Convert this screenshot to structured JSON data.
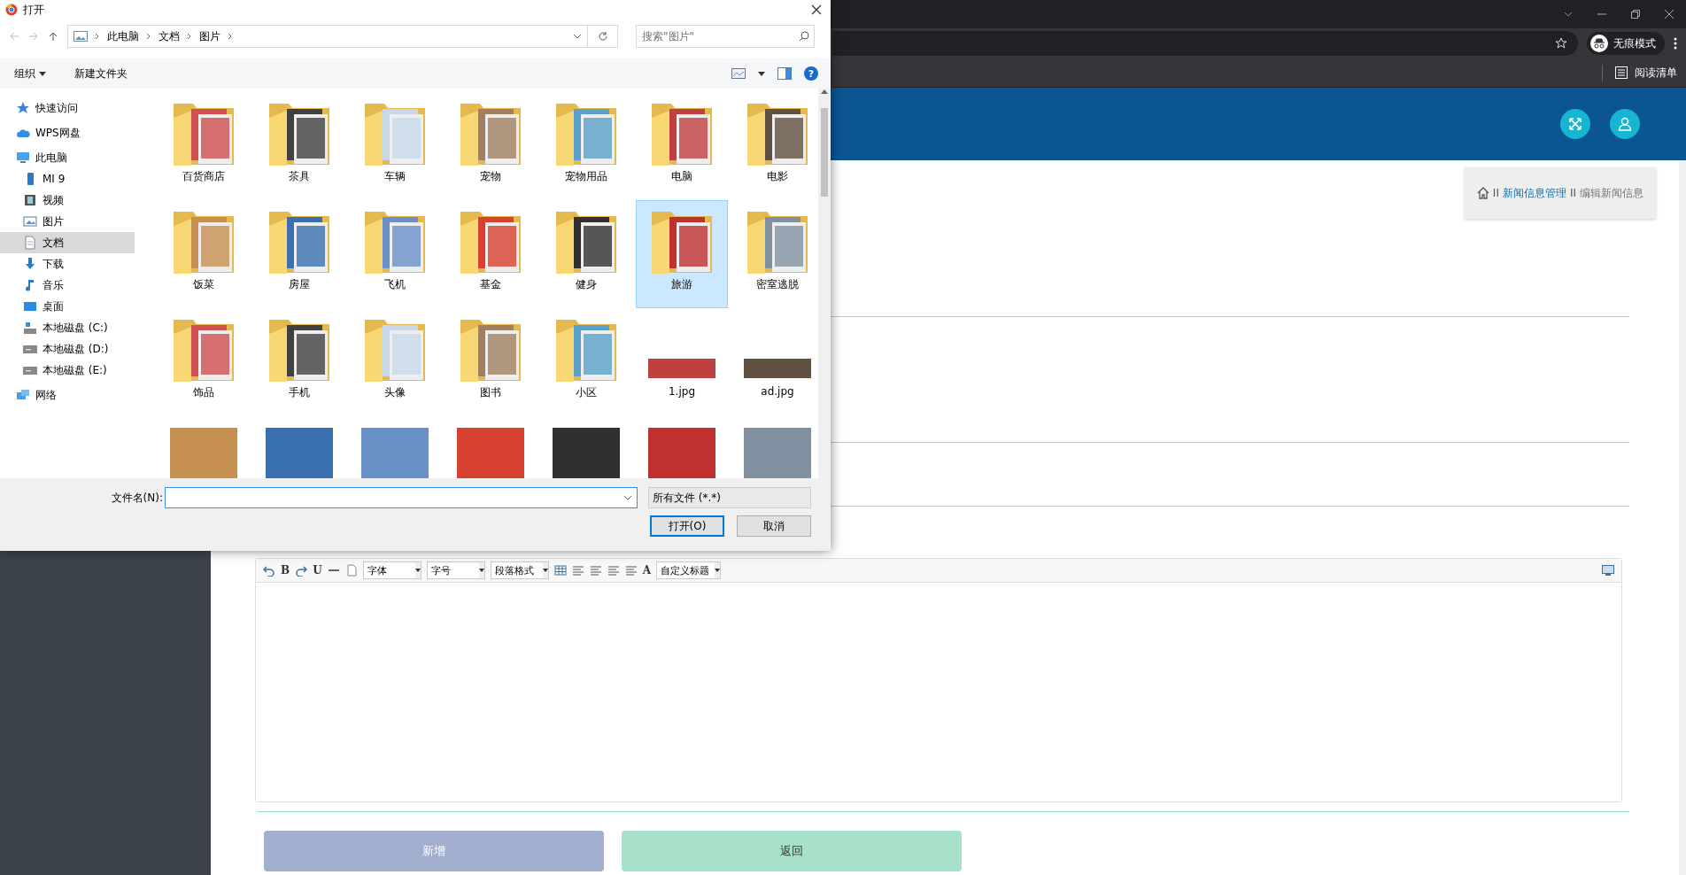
{
  "dialog": {
    "title": "打开",
    "path": [
      "此电脑",
      "文档",
      "图片"
    ],
    "search": {
      "placeholder": "搜索\"图片\""
    },
    "toolbar": {
      "organize": "组织",
      "new_folder": "新建文件夹",
      "help": "?"
    },
    "nav": [
      {
        "label": "快速访问",
        "kind": "star",
        "selected": false
      },
      {
        "label": "WPS网盘",
        "kind": "cloud",
        "selected": false
      },
      {
        "label": "此电脑",
        "kind": "computer",
        "selected": false,
        "children": [
          {
            "label": "MI 9",
            "kind": "phone",
            "selected": false
          },
          {
            "label": "视频",
            "kind": "video",
            "selected": false
          },
          {
            "label": "图片",
            "kind": "picture",
            "selected": false
          },
          {
            "label": "文档",
            "kind": "document",
            "selected": true
          },
          {
            "label": "下载",
            "kind": "download",
            "selected": false
          },
          {
            "label": "音乐",
            "kind": "music",
            "selected": false
          },
          {
            "label": "桌面",
            "kind": "desktop",
            "selected": false
          },
          {
            "label": "本地磁盘 (C:)",
            "kind": "system-drive",
            "selected": false
          },
          {
            "label": "本地磁盘 (D:)",
            "kind": "drive",
            "selected": false
          },
          {
            "label": "本地磁盘 (E:)",
            "kind": "drive",
            "selected": false
          }
        ]
      },
      {
        "label": "网络",
        "kind": "network",
        "selected": false
      }
    ],
    "files": [
      {
        "name": "百货商店",
        "kind": "folder",
        "selected": false
      },
      {
        "name": "茶具",
        "kind": "folder",
        "selected": false
      },
      {
        "name": "车辆",
        "kind": "folder",
        "selected": false
      },
      {
        "name": "宠物",
        "kind": "folder",
        "selected": false
      },
      {
        "name": "宠物用品",
        "kind": "folder",
        "selected": false
      },
      {
        "name": "电脑",
        "kind": "folder",
        "selected": false
      },
      {
        "name": "电影",
        "kind": "folder",
        "selected": false
      },
      {
        "name": "饭菜",
        "kind": "folder",
        "selected": false
      },
      {
        "name": "房屋",
        "kind": "folder",
        "selected": false
      },
      {
        "name": "飞机",
        "kind": "folder",
        "selected": false
      },
      {
        "name": "基金",
        "kind": "folder",
        "selected": false
      },
      {
        "name": "健身",
        "kind": "folder",
        "selected": false
      },
      {
        "name": "旅游",
        "kind": "folder",
        "selected": true
      },
      {
        "name": "密室逃脱",
        "kind": "folder",
        "selected": false
      },
      {
        "name": "饰品",
        "kind": "folder",
        "selected": false
      },
      {
        "name": "手机",
        "kind": "folder",
        "selected": false
      },
      {
        "name": "头像",
        "kind": "folder",
        "selected": false
      },
      {
        "name": "图书",
        "kind": "folder",
        "selected": false
      },
      {
        "name": "小区",
        "kind": "folder",
        "selected": false
      },
      {
        "name": "1.jpg",
        "kind": "image",
        "selected": false
      },
      {
        "name": "ad.jpg",
        "kind": "image",
        "selected": false
      },
      {
        "kind": "image",
        "selected": false
      },
      {
        "kind": "image",
        "selected": false
      },
      {
        "kind": "image",
        "selected": false
      },
      {
        "kind": "image",
        "selected": false
      },
      {
        "kind": "image",
        "selected": false
      },
      {
        "kind": "image",
        "selected": false
      },
      {
        "kind": "image",
        "selected": false
      }
    ],
    "filename": {
      "label": "文件名(N):"
    },
    "filetype": "所有文件 (*.*)",
    "buttons": {
      "open": "打开(O)",
      "cancel": "取消"
    }
  },
  "browser": {
    "profile": "无痕模式",
    "reading_list": "阅读清单"
  },
  "page": {
    "breadcrumb": [
      {
        "separator": "II",
        "label": "新闻信息管理",
        "kind": "link"
      },
      {
        "separator": "II",
        "label": "编辑新闻信息",
        "kind": "current"
      }
    ],
    "editor": [
      {
        "kind": "undo"
      },
      {
        "kind": "text",
        "label": "B"
      },
      {
        "kind": "redo"
      },
      {
        "kind": "text",
        "label": "U"
      },
      {
        "kind": "rule"
      },
      {
        "kind": "doc"
      },
      {
        "kind": "select",
        "label": "字体"
      },
      {
        "kind": "select",
        "label": "字号"
      },
      {
        "kind": "select",
        "label": "段落格式"
      },
      {
        "kind": "table"
      },
      {
        "kind": "align"
      },
      {
        "kind": "align"
      },
      {
        "kind": "align"
      },
      {
        "kind": "align"
      },
      {
        "kind": "text",
        "label": "A"
      },
      {
        "kind": "select",
        "label": "自定义标题"
      }
    ],
    "buttons": [
      {
        "label": "新增",
        "kind": "submit"
      },
      {
        "label": "返回",
        "kind": "back"
      }
    ]
  }
}
